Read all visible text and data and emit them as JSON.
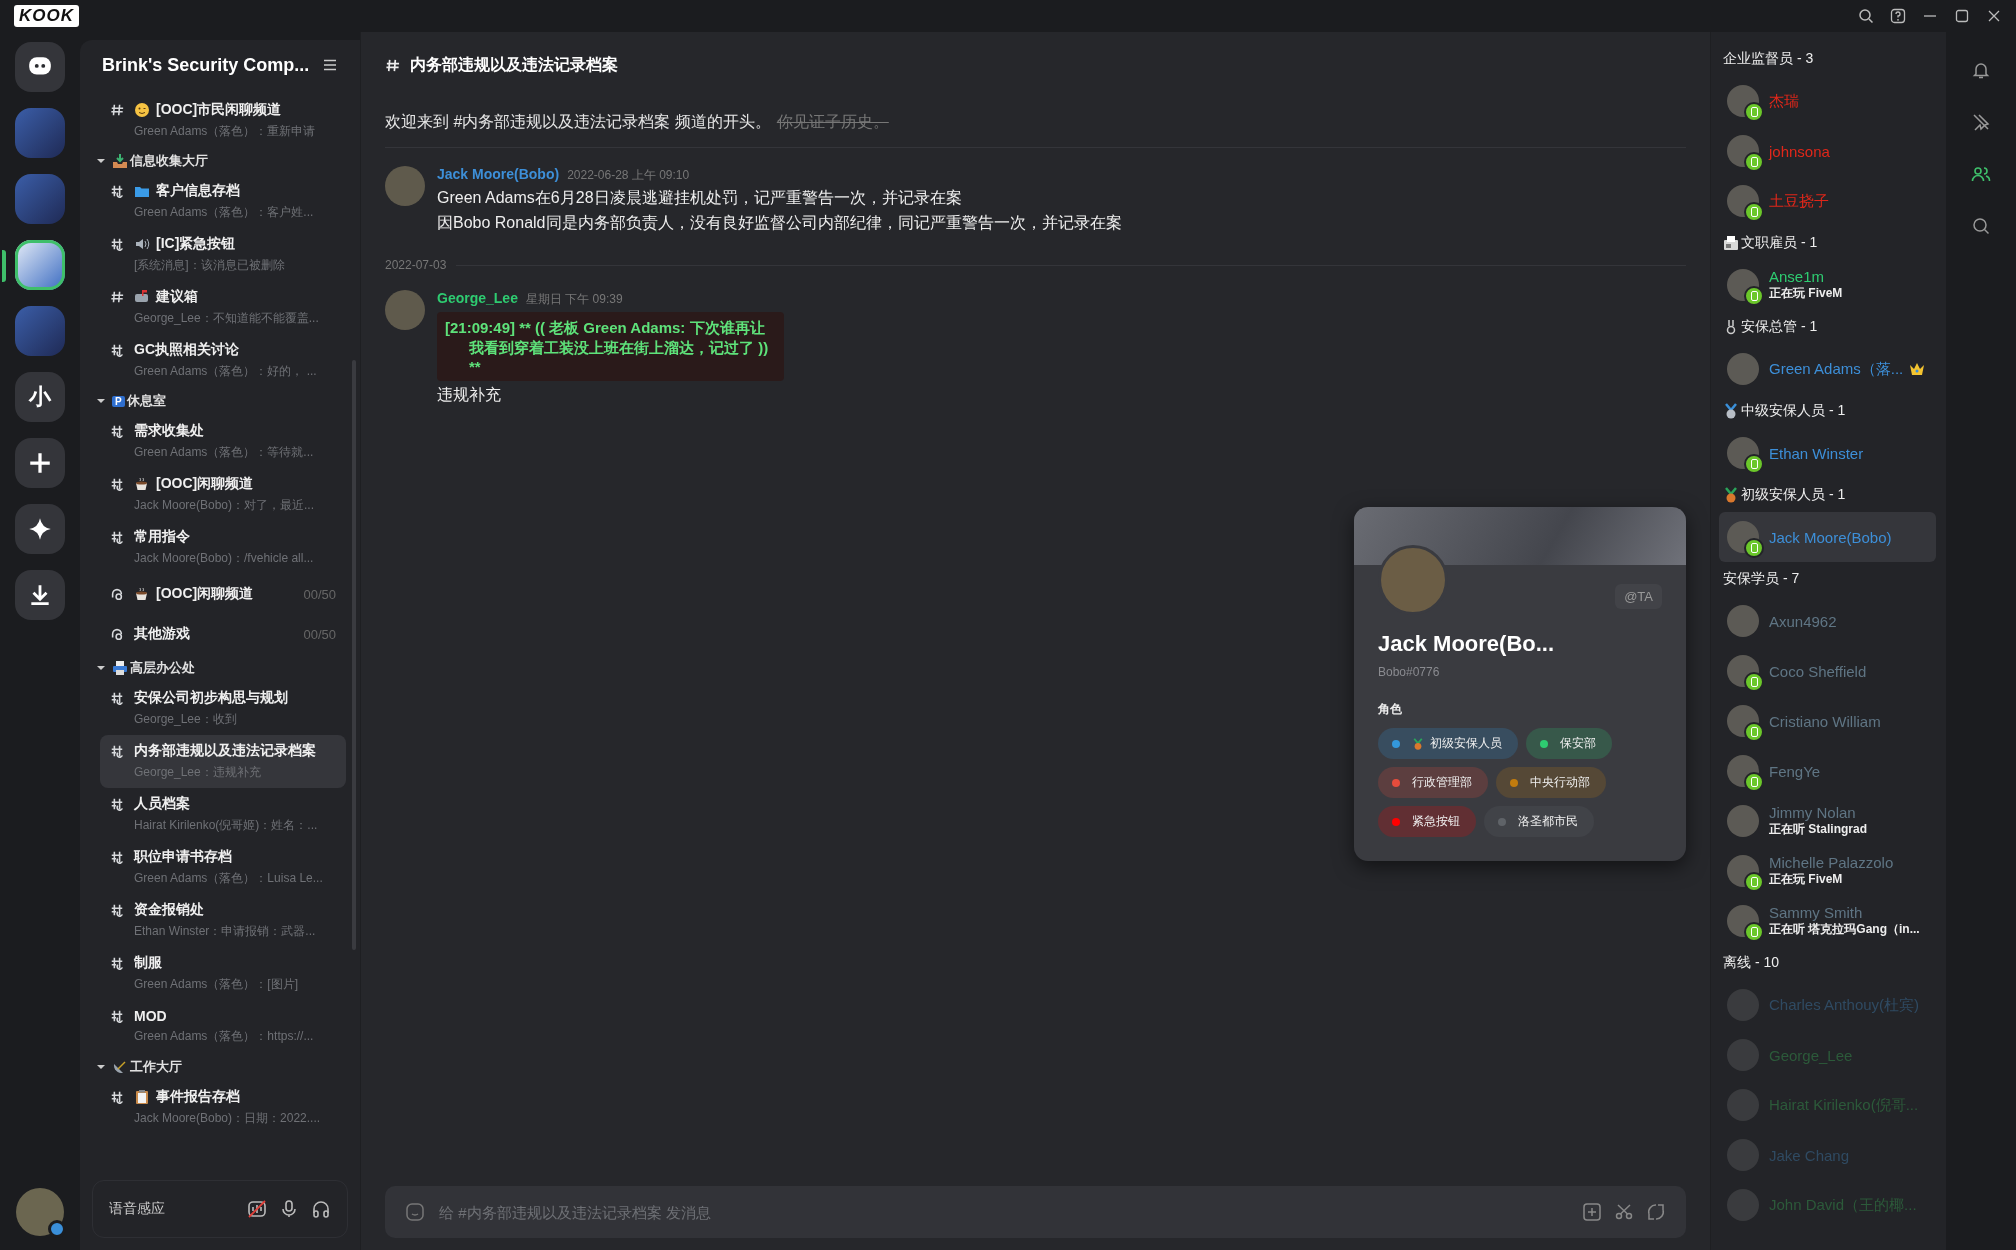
{
  "app": {
    "logo": "KOOK"
  },
  "servers": [
    {
      "kind": "dm",
      "selected": false
    },
    {
      "kind": "image",
      "selected": false
    },
    {
      "kind": "image",
      "selected": false
    },
    {
      "kind": "image",
      "selected": true
    },
    {
      "kind": "image",
      "selected": false
    },
    {
      "kind": "text",
      "label": "小",
      "selected": false
    },
    {
      "kind": "add",
      "selected": false
    },
    {
      "kind": "discover",
      "selected": false
    },
    {
      "kind": "download",
      "selected": false
    }
  ],
  "guild": {
    "name": "Brink's Security Comp..."
  },
  "channels": [
    {
      "kind": "text",
      "emoji": {
        "kind": "face"
      },
      "name": "[OOC]市民闲聊频道",
      "preview": "Green Adams（落色）：重新申请",
      "selected": false
    },
    {
      "kind": "category",
      "emoji": {
        "kind": "inbox"
      },
      "name": "信息收集大厅",
      "expanded": true
    },
    {
      "kind": "text-limited",
      "emoji": {
        "kind": "folder"
      },
      "name": "客户信息存档",
      "preview": "Green Adams（落色）：客户姓...",
      "selected": false
    },
    {
      "kind": "text-limited",
      "emoji": {
        "kind": "speaker"
      },
      "name": "[IC]紧急按钮",
      "preview": "[系统消息]：该消息已被删除",
      "selected": false
    },
    {
      "kind": "text",
      "emoji": {
        "kind": "mailbox"
      },
      "name": "建议箱",
      "preview": "George_Lee：不知道能不能覆盖...",
      "selected": false
    },
    {
      "kind": "text-limited",
      "name": "GC执照相关讨论",
      "preview": "Green Adams（落色）：好的，  ...",
      "selected": false
    },
    {
      "kind": "category",
      "badge": "P",
      "name": "休息室",
      "expanded": true
    },
    {
      "kind": "text-limited",
      "name": "需求收集处",
      "preview": "Green Adams（落色）：等待就...",
      "selected": false
    },
    {
      "kind": "text-limited",
      "emoji": {
        "kind": "coffee"
      },
      "name": "[OOC]闲聊频道",
      "preview": "Jack Moore(Bobo)：对了，最近...",
      "selected": false
    },
    {
      "kind": "text-limited",
      "name": "常用指令",
      "preview": "Jack Moore(Bobo)：/fvehicle all...",
      "selected": false
    },
    {
      "kind": "voice",
      "emoji": {
        "kind": "coffee"
      },
      "name": "[OOC]闲聊频道",
      "count": "00/50",
      "selected": false
    },
    {
      "kind": "voice",
      "name": "其他游戏",
      "count": "00/50",
      "selected": false
    },
    {
      "kind": "category",
      "emoji": {
        "kind": "printer"
      },
      "name": "高层办公处",
      "expanded": true
    },
    {
      "kind": "text-limited",
      "name": "安保公司初步构思与规划",
      "preview": "George_Lee：收到",
      "selected": false
    },
    {
      "kind": "text-limited",
      "name": "内务部违规以及违法记录档案",
      "preview": "George_Lee：违规补充",
      "selected": true
    },
    {
      "kind": "text-limited",
      "name": "人员档案",
      "preview": "Hairat Kirilenko(倪哥姬)：姓名：...",
      "selected": false
    },
    {
      "kind": "text-limited",
      "name": "职位申请书存档",
      "preview": "Green Adams（落色）：Luisa Le...",
      "selected": false
    },
    {
      "kind": "text-limited",
      "name": "资金报销处",
      "preview": "Ethan Winster：申请报销：武器...",
      "selected": false
    },
    {
      "kind": "text-limited",
      "name": "制服",
      "preview": "Green Adams（落色）：[图片]",
      "selected": false
    },
    {
      "kind": "text-limited",
      "name": "MOD",
      "preview": "Green Adams（落色）：https://...",
      "selected": false
    },
    {
      "kind": "category",
      "emoji": {
        "kind": "satellite"
      },
      "name": "工作大厅",
      "expanded": true
    },
    {
      "kind": "text-limited",
      "emoji": {
        "kind": "clipboard"
      },
      "name": "事件报告存档",
      "preview": "Jack Moore(Bobo)：日期：2022....",
      "selected": false
    }
  ],
  "voice_bar": {
    "label": "语音感应"
  },
  "chat": {
    "channel": "内务部违规以及违法记录档案",
    "welcome": "欢迎来到 #内务部违规以及违法记录档案 频道的开头。",
    "welcome_struck": "你见证子历史。",
    "messages": [
      {
        "kind": "message",
        "author": "Jack Moore(Bobo)",
        "color": "#3d8fd8",
        "time": "2022-06-28 上午 09:10",
        "lines": [
          "Green Adams在6月28日凌晨逃避挂机处罚，记严重警告一次，并记录在案",
          "因Bobo Ronald同是内务部负责人，没有良好监督公司内部纪律，同记严重警告一次，并记录在案"
        ]
      },
      {
        "kind": "divider",
        "date": "2022-07-03"
      },
      {
        "kind": "message",
        "author": "George_Lee",
        "color": "#2ecc71",
        "time": "星期日 下午 09:39",
        "image_lines": [
          "[21:09:49] ** (( 老板 Green Adams: 下次谁再让",
          "我看到穿着工装没上班在街上溜达，记过了 ))",
          "**"
        ],
        "lines": [
          "违规补充"
        ]
      }
    ],
    "input": {
      "placeholder": "给 #内务部违规以及违法记录档案 发消息"
    }
  },
  "profile_card": {
    "mention": "@TA",
    "name": "Jack Moore(Bo...",
    "tag": "Bobo#0776",
    "roles_title": "角色",
    "roles": [
      {
        "emoji": {
          "kind": "medal-bronze"
        },
        "name": "初级安保人员",
        "color": "#3498db"
      },
      {
        "name": "保安部",
        "color": "#2ecc71"
      },
      {
        "name": "行政管理部",
        "color": "#e74c3c"
      },
      {
        "name": "中央行动部",
        "color": "#c27c0e"
      },
      {
        "name": "紧急按钮",
        "color": "#ff0000"
      },
      {
        "name": "洛圣都市民",
        "color": "#5f6368"
      }
    ]
  },
  "member_groups": [
    {
      "title": "企业监督员 - 3",
      "members": [
        {
          "name": "杰瑞",
          "color": "#e0271a",
          "mobile": true,
          "selected": false
        },
        {
          "name": "johnsona",
          "color": "#e0271a",
          "mobile": true,
          "selected": false
        },
        {
          "name": "土豆挠子",
          "color": "#e0271a",
          "mobile": true,
          "selected": false
        }
      ]
    },
    {
      "emoji": {
        "kind": "fax"
      },
      "title": "文职雇员 - 1",
      "members": [
        {
          "name": "Anse1m",
          "activity": "正在玩 FiveM",
          "color": "#2ecc71",
          "mobile": true,
          "selected": false
        }
      ]
    },
    {
      "emoji": {
        "kind": "medal-small"
      },
      "title": "安保总管 - 1",
      "members": [
        {
          "name": "Green Adams（落...",
          "color": "#3d8fd8",
          "mobile": false,
          "crown": true,
          "selected": false
        }
      ]
    },
    {
      "emoji": {
        "kind": "medal-silver"
      },
      "title": "中级安保人员 - 1",
      "members": [
        {
          "name": "Ethan Winster",
          "color": "#3d8fd8",
          "mobile": true,
          "selected": false
        }
      ]
    },
    {
      "emoji": {
        "kind": "medal-bronze"
      },
      "title": "初级安保人员 - 1",
      "members": [
        {
          "name": "Jack Moore(Bobo)",
          "color": "#3d8fd8",
          "mobile": true,
          "selected": true
        }
      ]
    },
    {
      "title": "安保学员 - 7",
      "members": [
        {
          "name": "Axun4962",
          "color": "#5f7584",
          "mobile": false,
          "selected": false
        },
        {
          "name": "Coco Sheffield",
          "color": "#5f7584",
          "mobile": true,
          "selected": false
        },
        {
          "name": "Cristiano William",
          "color": "#5f7584",
          "mobile": true,
          "selected": false
        },
        {
          "name": "FengYe",
          "color": "#5f7584",
          "mobile": true,
          "selected": false
        },
        {
          "name": "Jimmy Nolan",
          "activity": "正在听 Stalingrad",
          "color": "#5f7584",
          "mobile": false,
          "selected": false
        },
        {
          "name": "Michelle Palazzolo",
          "activity": "正在玩 FiveM",
          "color": "#5f7584",
          "mobile": true,
          "selected": false
        },
        {
          "name": "Sammy Smith",
          "activity": "正在听 塔克拉玛Gang（in...",
          "color": "#5f7584",
          "mobile": true,
          "selected": false
        }
      ]
    },
    {
      "title": "离线 - 10",
      "offline": true,
      "members": [
        {
          "name": "Charles Anthouy(杜宾)",
          "color": "#2f4a62",
          "mobile": false,
          "selected": false
        },
        {
          "name": "George_Lee",
          "color": "#2c5a3a",
          "mobile": false,
          "selected": false
        },
        {
          "name": "Hairat Kirilenko(倪哥...",
          "color": "#2c5a3a",
          "mobile": false,
          "selected": false
        },
        {
          "name": "Jake Chang",
          "color": "#2f4a62",
          "mobile": false,
          "selected": false
        },
        {
          "name": "John David（王的椰...",
          "color": "#2c5a3a",
          "mobile": false,
          "selected": false
        }
      ]
    }
  ]
}
